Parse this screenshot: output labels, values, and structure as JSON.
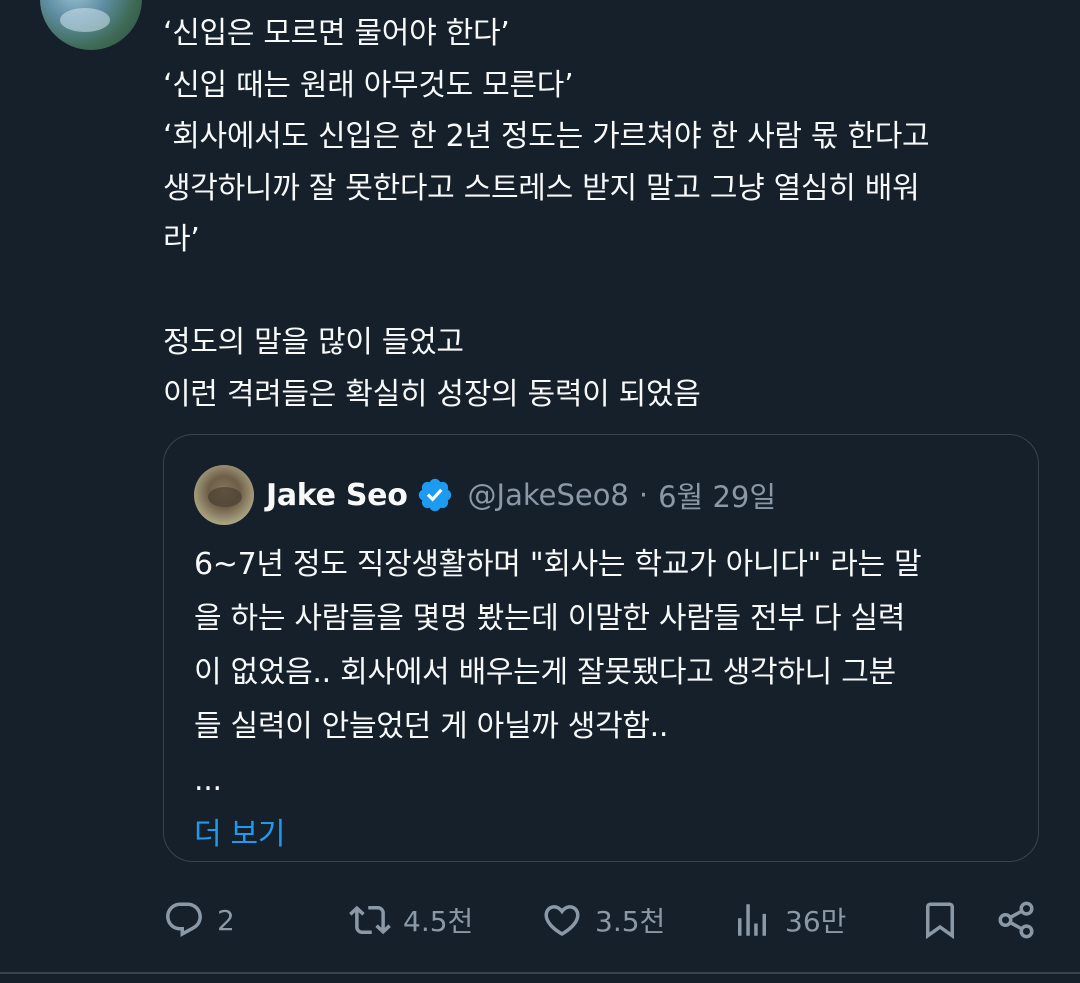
{
  "tweet": {
    "lines": [
      "‘신입은 모르면 물어야 한다’",
      "‘신입 때는 원래 아무것도 모른다’",
      "‘회사에서도 신입은 한 2년 정도는 가르쳐야 한 사람 몫 한다고",
      "생각하니까 잘 못한다고 스트레스 받지 말고 그냥 열심히 배워",
      "라’",
      "정도의 말을 많이 들었고",
      "이런 격려들은 확실히 성장의 동력이 되었음"
    ]
  },
  "quote": {
    "author_name": "Jake Seo",
    "handle": "@JakeSeo8",
    "separator": "·",
    "date": "6월 29일",
    "body_lines": [
      "6~7년 정도 직장생활하며 \"회사는 학교가 아니다\" 라는 말",
      "을 하는 사람들을 몇명 봤는데 이말한 사람들 전부 다 실력",
      "이 없었음.. 회사에서 배우는게 잘못됐다고 생각하니 그분",
      "들 실력이 안늘었던 게 아닐까 생각함..",
      "..."
    ],
    "show_more": "더 보기"
  },
  "actions": {
    "reply_count": "2",
    "retweet_count": "4.5천",
    "like_count": "3.5천",
    "views_count": "36만"
  },
  "icons": {
    "reply": "reply-icon",
    "retweet": "retweet-icon",
    "like": "heart-icon",
    "views": "views-icon",
    "bookmark": "bookmark-icon",
    "share": "share-icon",
    "verified": "verified-badge-icon"
  },
  "colors": {
    "background": "#15202b",
    "text": "#f7f9f9",
    "secondary_text": "#8b98a5",
    "accent": "#1d9bf0",
    "border": "#38444d"
  }
}
